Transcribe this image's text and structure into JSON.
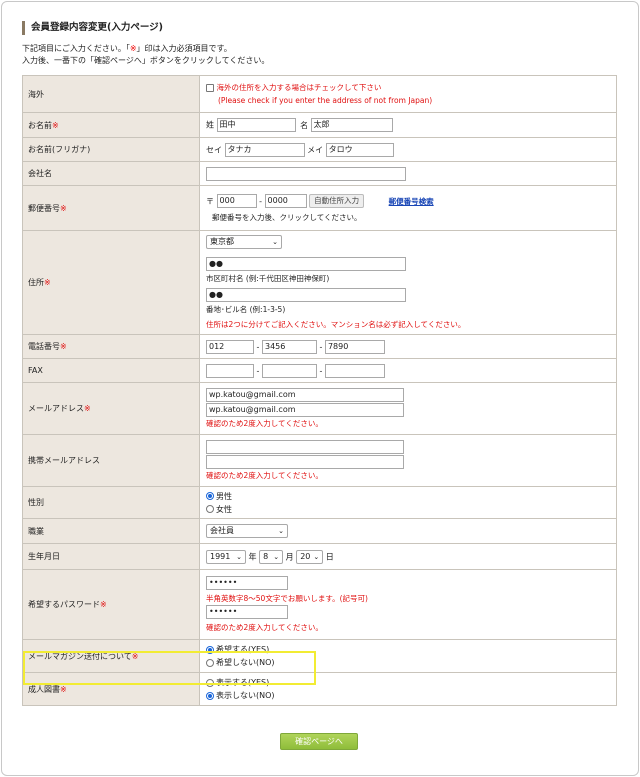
{
  "page": {
    "title": "会員登録内容変更(入力ページ)",
    "intro_line1_pre": "下記項目にご入力ください。「",
    "intro_line1_mark": "※",
    "intro_line1_post": "」印は入力必須項目です。",
    "intro_line2": "入力後、一番下の「確認ページへ」ボタンをクリックしてください。"
  },
  "req_mark": "※",
  "overseas": {
    "label": "海外",
    "checkbox_text": "海外の住所を入力する場合はチェックして下さい",
    "checkbox_text_en": "(Please check if you enter the address of not from Japan)"
  },
  "name": {
    "label": "お名前",
    "sei_label": "姓",
    "sei_value": "田中",
    "mei_label": "名",
    "mei_value": "太郎"
  },
  "kana": {
    "label": "お名前(フリガナ)",
    "sei_label": "セイ",
    "sei_value": "タナカ",
    "mei_label": "メイ",
    "mei_value": "タロウ"
  },
  "company": {
    "label": "会社名",
    "value": ""
  },
  "postal": {
    "label": "郵便番号",
    "prefix": "〒",
    "part1": "000",
    "dash": "-",
    "part2": "0000",
    "auto_button": "自動住所入力",
    "search_link": "郵便番号検索",
    "hint": "郵便番号を入力後、クリックしてください。"
  },
  "address": {
    "label": "住所",
    "prefecture": "東京都",
    "city_value": "●●",
    "city_hint": "市区町村名 (例:千代田区神田神保町)",
    "street_value": "●●",
    "street_hint": "番地･ビル名 (例:1-3-5)",
    "note": "住所は2つに分けてご記入ください。マンション名は必ず記入してください。"
  },
  "phone": {
    "label": "電話番号",
    "p1": "012",
    "p2": "3456",
    "p3": "7890",
    "dash": "-"
  },
  "fax": {
    "label": "FAX",
    "p1": "",
    "p2": "",
    "p3": "",
    "dash": "-"
  },
  "email": {
    "label": "メールアドレス",
    "value1": "wp.katou@gmail.com",
    "value2": "wp.katou@gmail.com",
    "note": "確認のため2度入力してください。"
  },
  "mobile_email": {
    "label": "携帯メールアドレス",
    "value1": "",
    "value2": "",
    "note": "確認のため2度入力してください。"
  },
  "gender": {
    "label": "性別",
    "opt_male": "男性",
    "opt_female": "女性",
    "selected": "male"
  },
  "job": {
    "label": "職業",
    "value": "会社員"
  },
  "birth": {
    "label": "生年月日",
    "year": "1991",
    "year_unit": "年",
    "month": "8",
    "month_unit": "月",
    "day": "20",
    "day_unit": "日"
  },
  "password": {
    "label": "希望するパスワード",
    "value1": "••••••",
    "hint": "半角英数字8～50文字でお願いします。(記号可)",
    "value2": "••••••",
    "note": "確認のため2度入力してください。"
  },
  "magazine": {
    "label": "メールマガジン送付について",
    "opt_yes": "希望する(YES)",
    "opt_no": "希望しない(NO)",
    "selected": "yes"
  },
  "adult": {
    "label": "成人図書",
    "opt_yes": "表示する(YES)",
    "opt_no": "表示しない(NO)",
    "selected": "no"
  },
  "submit_label": "確認ページへ",
  "colors": {
    "label_bg": "#ede7df",
    "required": "#e01010",
    "highlight": "#f2ec33",
    "submit_bg": "#9cc846",
    "link": "#1845b5"
  }
}
